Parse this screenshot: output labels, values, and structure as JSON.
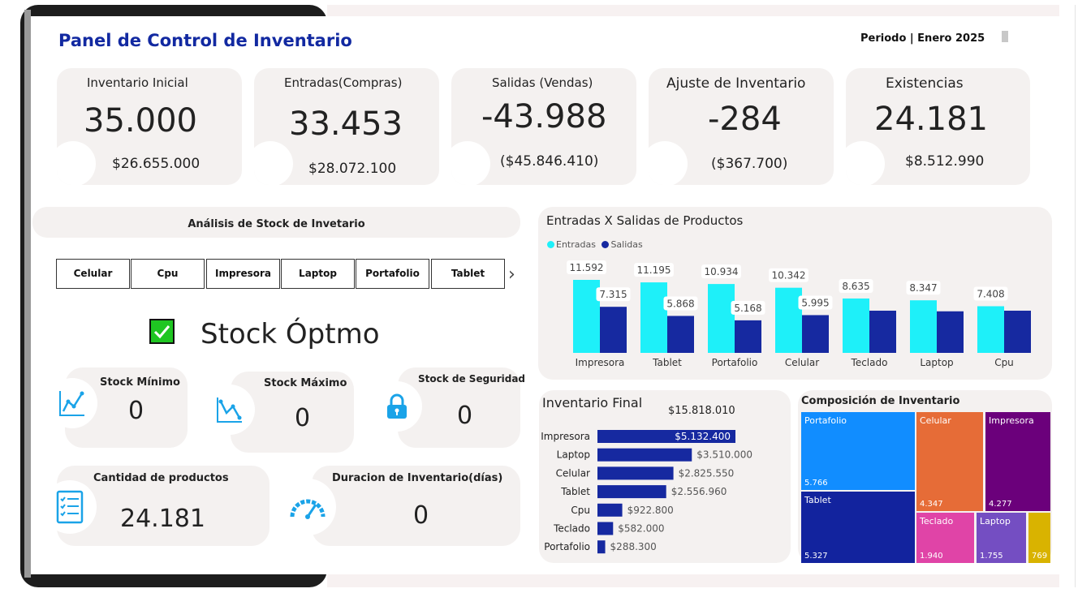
{
  "header": {
    "title": "Panel de Control de Inventario",
    "period": "Periodo | Enero 2025"
  },
  "kpis": [
    {
      "label": "Inventario Inicial",
      "value": "35.000",
      "amount": "$26.655.000"
    },
    {
      "label": "Entradas(Compras)",
      "value": "33.453",
      "amount": "$28.072.100"
    },
    {
      "label": "Salidas (Vendas)",
      "value": "-43.988",
      "amount": "($45.846.410)"
    },
    {
      "label": "Ajuste de Inventario",
      "value": "-284",
      "amount": "($367.700)"
    },
    {
      "label": "Existencias",
      "value": "24.181",
      "amount": "$8.512.990"
    }
  ],
  "stock": {
    "title": "Análisis de Stock de Invetario",
    "tabs": [
      "Celular",
      "Cpu",
      "Impresora",
      "Laptop",
      "Portafolio",
      "Tablet"
    ],
    "status": "Stock Óptmo",
    "minimo": {
      "label": "Stock Mínimo",
      "value": "0"
    },
    "maximo": {
      "label": "Stock Máximo",
      "value": "0"
    },
    "seguridad": {
      "label": "Stock de Seguridad",
      "value": "0"
    },
    "cantidad": {
      "label": "Cantidad de productos",
      "value": "24.181"
    },
    "duracion": {
      "label": "Duracion de Inventario(días)",
      "value": "0"
    }
  },
  "icons": {
    "next": "chevron-right-icon",
    "check": "checkbox-checked-icon",
    "min": "line-chart-icon",
    "max": "line-chart-icon",
    "seguridad": "lock-icon",
    "cantidad": "checklist-icon",
    "duracion": "gauge-icon"
  },
  "colors": {
    "title": "#1229a1",
    "entradas": "#1ef0f9",
    "salidas": "#1629a0",
    "bar": "#1629a0",
    "icon": "#1aa3e8"
  },
  "chart_data": [
    {
      "type": "bar",
      "title": "Entradas X Salidas de Productos",
      "categories": [
        "Impresora",
        "Tablet",
        "Portafolio",
        "Celular",
        "Teclado",
        "Laptop",
        "Cpu"
      ],
      "series": [
        {
          "name": "Entradas",
          "values": [
            11592,
            11195,
            10934,
            10342,
            8635,
            8347,
            7408
          ],
          "labels": [
            "11.592",
            "11.195",
            "10.934",
            "10.342",
            "8.635",
            "8.347",
            "7.408"
          ]
        },
        {
          "name": "Salidas",
          "values": [
            7315,
            5868,
            5168,
            5995,
            6700,
            6600,
            6700
          ],
          "labels": [
            "7.315",
            "5.868",
            "5.168",
            "5.995",
            "",
            "",
            ""
          ]
        }
      ]
    },
    {
      "type": "bar",
      "orientation": "horizontal",
      "title": "Inventario Final",
      "total": "$15.818.010",
      "categories": [
        "Impresora",
        "Laptop",
        "Celular",
        "Tablet",
        "Cpu",
        "Teclado",
        "Portafolio"
      ],
      "values": [
        5132400,
        3510000,
        2825550,
        2556960,
        922800,
        582000,
        288300
      ],
      "labels": [
        "$5.132.400",
        "$3.510.000",
        "$2.825.550",
        "$2.556.960",
        "$922.800",
        "$582.000",
        "$288.300"
      ]
    },
    {
      "type": "treemap",
      "title": "Composición de Inventario",
      "items": [
        {
          "name": "Portafolio",
          "value": 5766,
          "label": "5.766",
          "color": "#118dff"
        },
        {
          "name": "Tablet",
          "value": 5327,
          "label": "5.327",
          "color": "#12239e"
        },
        {
          "name": "Celular",
          "value": 4347,
          "label": "4.347",
          "color": "#e66c37"
        },
        {
          "name": "Impresora",
          "value": 4277,
          "label": "4.277",
          "color": "#6b007b"
        },
        {
          "name": "Teclado",
          "value": 1940,
          "label": "1.940",
          "color": "#e044a7"
        },
        {
          "name": "Laptop",
          "value": 1755,
          "label": "1.755",
          "color": "#744ec2"
        },
        {
          "name": "",
          "value": 769,
          "label": "769",
          "color": "#d9b300"
        }
      ]
    }
  ]
}
